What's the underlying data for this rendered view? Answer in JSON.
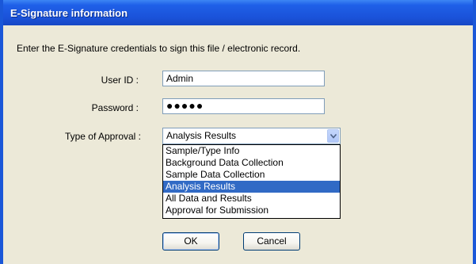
{
  "window": {
    "title": "E-Signature information"
  },
  "instructions": "Enter the E-Signature credentials to sign this file / electronic record.",
  "form": {
    "user_id_label": "User ID :",
    "user_id_value": "Admin",
    "password_label": "Password :",
    "password_value": "●●●●●",
    "approval_label": "Type of Approval :",
    "approval_selected": "Analysis Results"
  },
  "approval_options": [
    "Sample/Type Info",
    "Background Data Collection",
    "Sample Data Collection",
    "Analysis Results",
    "All Data and Results",
    "Approval for Submission"
  ],
  "buttons": {
    "ok": "OK",
    "cancel": "Cancel"
  },
  "colors": {
    "title_bar": "#1a52d9",
    "selection": "#316ac5",
    "dialog_bg": "#ece9d8"
  },
  "icons": {
    "dropdown": "chevron-down-icon"
  }
}
